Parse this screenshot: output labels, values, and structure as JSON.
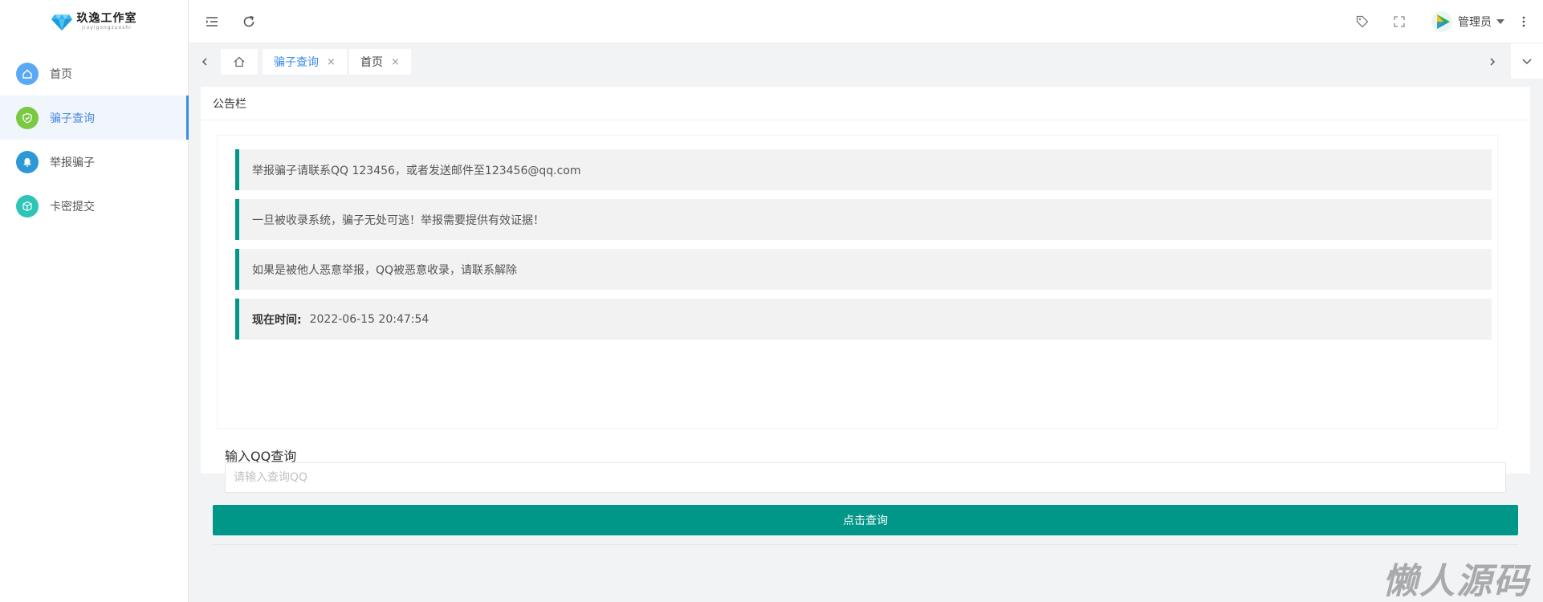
{
  "logo": {
    "title": "玖逸工作室",
    "subtitle": "jiuyigongzuoshi"
  },
  "sidebar": {
    "items": [
      {
        "label": "首页",
        "icon": "home-icon",
        "color": "#5aa9f5",
        "active": false
      },
      {
        "label": "骗子查询",
        "icon": "shield-icon",
        "color": "#7bc943",
        "active": true
      },
      {
        "label": "举报骗子",
        "icon": "bell-icon",
        "color": "#2d98d6",
        "active": false
      },
      {
        "label": "卡密提交",
        "icon": "cube-icon",
        "color": "#2ec5b6",
        "active": false
      }
    ]
  },
  "header": {
    "menu_toggle_icon": "menu-fold-icon",
    "refresh_icon": "refresh-icon",
    "tag_icon": "tag-icon",
    "fullscreen_icon": "fullscreen-icon",
    "user_name": "管理员",
    "more_icon": "more-vertical-icon"
  },
  "tabs": {
    "items": [
      {
        "label": "骗子查询",
        "active": true,
        "close": "×"
      },
      {
        "label": "首页",
        "active": false,
        "close": "×"
      }
    ]
  },
  "card": {
    "title": "公告栏",
    "notices": [
      {
        "text": "举报骗子请联系QQ 123456，或者发送邮件至123456@qq.com"
      },
      {
        "text": "一旦被收录系统，骗子无处可逃！举报需要提供有效证据！"
      },
      {
        "text": "如果是被他人恶意举报，QQ被恶意收录，请联系解除"
      }
    ],
    "time_label": "现在时间:",
    "time_value": "2022-06-15 20:47:54"
  },
  "query": {
    "label": "输入QQ查询",
    "placeholder": "请输入查询QQ",
    "value": "",
    "button": "点击查询"
  },
  "watermark": "懒人源码",
  "colors": {
    "accent": "#009688",
    "active_blue": "#3b8ce8"
  }
}
